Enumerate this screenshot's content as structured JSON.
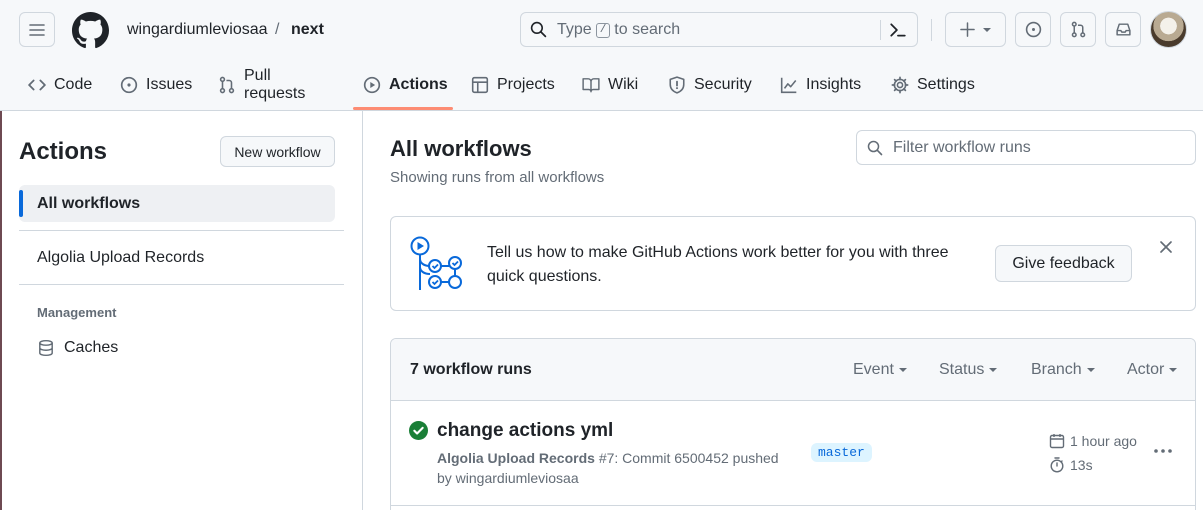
{
  "header": {
    "owner": "wingardiumleviosaa",
    "separator": "/",
    "repo": "next",
    "search": {
      "prefix": "Type",
      "key": "/",
      "suffix": "to search"
    }
  },
  "tabs": [
    {
      "label": "Code",
      "icon": "code-icon"
    },
    {
      "label": "Issues",
      "icon": "issue-icon"
    },
    {
      "label": "Pull requests",
      "icon": "pull-request-icon"
    },
    {
      "label": "Actions",
      "icon": "play-icon",
      "active": true
    },
    {
      "label": "Projects",
      "icon": "table-icon"
    },
    {
      "label": "Wiki",
      "icon": "book-icon"
    },
    {
      "label": "Security",
      "icon": "shield-icon"
    },
    {
      "label": "Insights",
      "icon": "graph-icon"
    },
    {
      "label": "Settings",
      "icon": "gear-icon"
    }
  ],
  "sidebar": {
    "title": "Actions",
    "new_workflow": "New workflow",
    "items": [
      {
        "label": "All workflows",
        "active": true
      },
      {
        "label": "Algolia Upload Records"
      }
    ],
    "management_heading": "Management",
    "caches": "Caches"
  },
  "main": {
    "title": "All workflows",
    "subtitle": "Showing runs from all workflows",
    "filter_placeholder": "Filter workflow runs",
    "feedback": {
      "text": "Tell us how to make GitHub Actions work better for you with three quick questions.",
      "button": "Give feedback"
    },
    "runs": {
      "count_label": "7 workflow runs",
      "filters": [
        "Event",
        "Status",
        "Branch",
        "Actor"
      ],
      "items": [
        {
          "title": "change actions yml",
          "workflow": "Algolia Upload Records",
          "detail": "#7: Commit 6500452 pushed by wingardiumleviosaa",
          "branch": "master",
          "time": "1 hour ago",
          "duration": "13s",
          "status": "success"
        }
      ]
    }
  },
  "colors": {
    "accent": "#0969da",
    "tab_underline": "#fd8c73",
    "success": "#1a7f37"
  }
}
